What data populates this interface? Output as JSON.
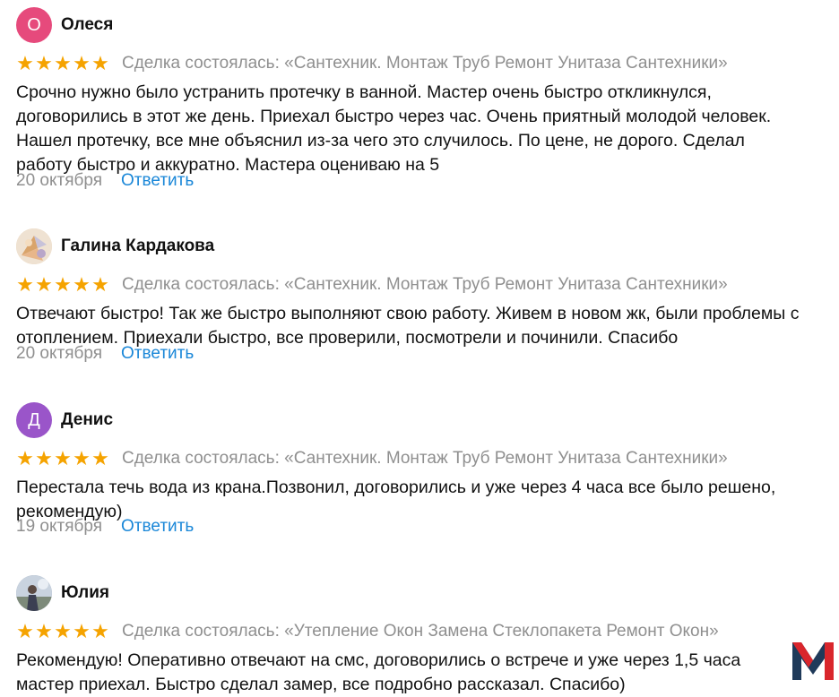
{
  "reviews": [
    {
      "author": "Олеся",
      "avatar_letter": "О",
      "avatar_color": "#e64a7c",
      "deal": "Сделка состоялась: «Сантехник. Монтаж Труб Ремонт Унитаза Сантехники»",
      "lines": [
        "Срочно нужно было устранить протечку в ванной. Мастер очень быстро откликнулся,",
        "договорились в этот же день. Приехал быстро через час. Очень приятный молодой человек.",
        "Нашел протечку, все мне объяснил из-за чего это случилось. По цене, не дорого. Сделал",
        "работу быстро и аккуратно. Мастера оцениваю на 5"
      ],
      "date": "20 октября",
      "reply": "Ответить"
    },
    {
      "author": "Галина Кардакова",
      "avatar_letter": "",
      "avatar_color": "#e8c9a0",
      "deal": "Сделка состоялась: «Сантехник. Монтаж Труб Ремонт Унитаза Сантехники»",
      "lines": [
        "Отвечают быстро! Так же быстро выполняют свою работу. Живем в новом жк, были проблемы с",
        "отоплением. Приехали быстро, все проверили, посмотрели и починили. Спасибо"
      ],
      "date": "20 октября",
      "reply": "Ответить"
    },
    {
      "author": "Денис",
      "avatar_letter": "Д",
      "avatar_color": "#9a55c9",
      "deal": "Сделка состоялась: «Сантехник. Монтаж Труб Ремонт Унитаза Сантехники»",
      "lines": [
        "Перестала течь вода из крана.Позвонил, договорились и уже через 4 часа все было решено,",
        "рекомендую)"
      ],
      "date": "19 октября",
      "reply": "Ответить"
    },
    {
      "author": "Юлия",
      "avatar_letter": "",
      "avatar_color": "#8c9bb0",
      "deal": "Сделка состоялась: «Утепление Окон Замена Стеклопакета Ремонт Окон»",
      "lines": [
        "Рекомендую! Оперативно отвечают на смс, договорились о встрече и уже через 1,5 часа",
        "мастер приехал. Быстро сделал замер, все подробно рассказал. Спасибо)"
      ],
      "date": "",
      "reply": ""
    }
  ],
  "rating": 5,
  "star_color": "#f5a300",
  "link_color": "#1a87d8"
}
